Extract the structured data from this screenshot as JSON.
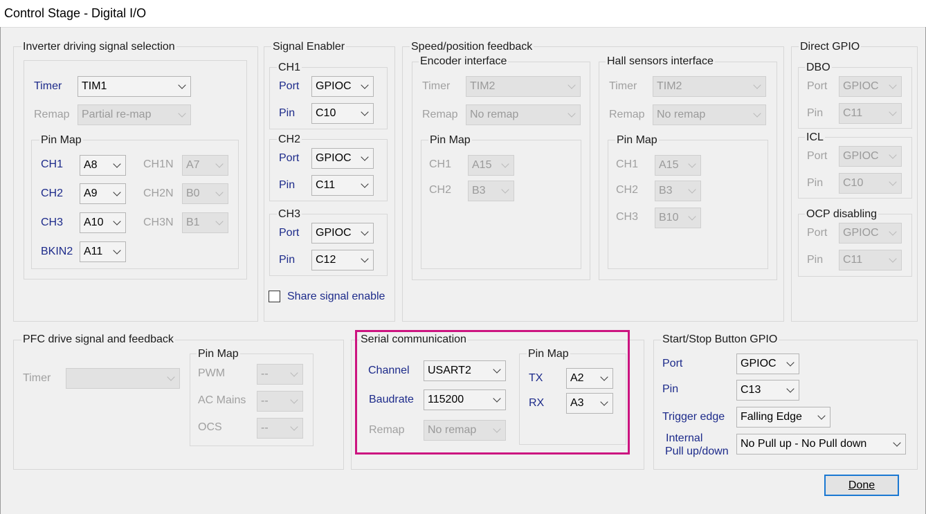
{
  "window": {
    "title": "Control Stage - Digital I/O"
  },
  "inverter": {
    "title": "Inverter driving signal selection",
    "timer_label": "Timer",
    "timer_value": "TIM1",
    "remap_label": "Remap",
    "remap_value": "Partial re-map",
    "pinmap_title": "Pin Map",
    "ch1_label": "CH1",
    "ch1_value": "A8",
    "ch1n_label": "CH1N",
    "ch1n_value": "A7",
    "ch2_label": "CH2",
    "ch2_value": "A9",
    "ch2n_label": "CH2N",
    "ch2n_value": "B0",
    "ch3_label": "CH3",
    "ch3_value": "A10",
    "ch3n_label": "CH3N",
    "ch3n_value": "B1",
    "bkin2_label": "BKIN2",
    "bkin2_value": "A11"
  },
  "signal_enabler": {
    "title": "Signal Enabler",
    "ch1_title": "CH1",
    "ch1_port_label": "Port",
    "ch1_port": "GPIOC",
    "ch1_pin_label": "Pin",
    "ch1_pin": "C10",
    "ch2_title": "CH2",
    "ch2_port_label": "Port",
    "ch2_port": "GPIOC",
    "ch2_pin_label": "Pin",
    "ch2_pin": "C11",
    "ch3_title": "CH3",
    "ch3_port_label": "Port",
    "ch3_port": "GPIOC",
    "ch3_pin_label": "Pin",
    "ch3_pin": "C12",
    "share_label": "Share signal enable"
  },
  "speed": {
    "title": "Speed/position feedback",
    "encoder": {
      "title": "Encoder interface",
      "timer_label": "Timer",
      "timer_value": "TIM2",
      "remap_label": "Remap",
      "remap_value": "No remap",
      "pinmap_title": "Pin Map",
      "ch1_label": "CH1",
      "ch1_value": "A15",
      "ch2_label": "CH2",
      "ch2_value": "B3"
    },
    "hall": {
      "title": "Hall sensors interface",
      "timer_label": "Timer",
      "timer_value": "TIM2",
      "remap_label": "Remap",
      "remap_value": "No remap",
      "pinmap_title": "Pin Map",
      "ch1_label": "CH1",
      "ch1_value": "A15",
      "ch2_label": "CH2",
      "ch2_value": "B3",
      "ch3_label": "CH3",
      "ch3_value": "B10"
    }
  },
  "direct_gpio": {
    "title": "Direct GPIO",
    "dbo_title": "DBO",
    "dbo_port_label": "Port",
    "dbo_port": "GPIOC",
    "dbo_pin_label": "Pin",
    "dbo_pin": "C11",
    "icl_title": "ICL",
    "icl_port_label": "Port",
    "icl_port": "GPIOC",
    "icl_pin_label": "Pin",
    "icl_pin": "C10",
    "ocp_title": "OCP disabling",
    "ocp_port_label": "Port",
    "ocp_port": "GPIOC",
    "ocp_pin_label": "Pin",
    "ocp_pin": "C11"
  },
  "pfc": {
    "title": "PFC drive signal and feedback",
    "timer_label": "Timer",
    "timer_value": "",
    "pinmap_title": "Pin Map",
    "pwm_label": "PWM",
    "pwm_value": "--",
    "acmains_label": "AC Mains",
    "acmains_value": "--",
    "ocs_label": "OCS",
    "ocs_value": "--"
  },
  "serial": {
    "title": "Serial communication",
    "channel_label": "Channel",
    "channel_value": "USART2",
    "baud_label": "Baudrate",
    "baud_value": "115200",
    "remap_label": "Remap",
    "remap_value": "No remap",
    "pinmap_title": "Pin Map",
    "tx_label": "TX",
    "tx_value": "A2",
    "rx_label": "RX",
    "rx_value": "A3"
  },
  "startstop": {
    "title": "Start/Stop Button GPIO",
    "port_label": "Port",
    "port_value": "GPIOC",
    "pin_label": "Pin",
    "pin_value": "C13",
    "trigger_label": "Trigger edge",
    "trigger_value": "Falling Edge",
    "pull_label_1": "Internal",
    "pull_label_2": "Pull up/down",
    "pull_value": "No Pull up - No Pull down"
  },
  "done_label": "Done",
  "colors": {
    "label_blue": "#1c2a8a",
    "highlight": "#cc1480",
    "done_border": "#1a78d2"
  }
}
